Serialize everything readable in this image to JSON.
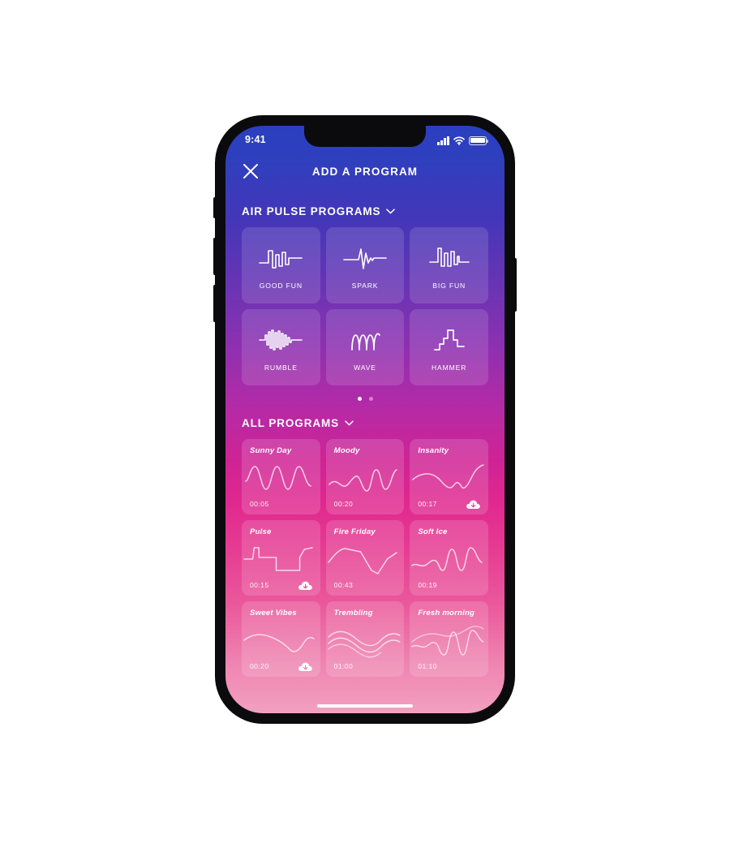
{
  "status_bar": {
    "time": "9:41",
    "signal_icon": "cellular-signal-icon",
    "wifi_icon": "wifi-icon",
    "battery_icon": "battery-icon"
  },
  "header": {
    "close_icon": "close-icon",
    "title": "ADD A PROGRAM"
  },
  "sections": {
    "air_pulse": {
      "title": "AIR PULSE PROGRAMS",
      "chevron_icon": "chevron-down-icon",
      "tiles": [
        {
          "label": "GOOD FUN",
          "icon": "waveform-good-fun-icon"
        },
        {
          "label": "SPARK",
          "icon": "waveform-spark-icon"
        },
        {
          "label": "BIG FUN",
          "icon": "waveform-big-fun-icon"
        },
        {
          "label": "RUMBLE",
          "icon": "waveform-rumble-icon"
        },
        {
          "label": "WAVE",
          "icon": "waveform-wave-icon"
        },
        {
          "label": "HAMMER",
          "icon": "waveform-hammer-icon"
        }
      ],
      "pagination": {
        "total": 2,
        "active": 1
      }
    },
    "all_programs": {
      "title": "ALL PROGRAMS",
      "chevron_icon": "chevron-down-icon",
      "programs": [
        {
          "name": "Sunny Day",
          "duration": "00:05",
          "downloadable": false
        },
        {
          "name": "Moody",
          "duration": "00:20",
          "downloadable": false
        },
        {
          "name": "Insanity",
          "duration": "00:17",
          "downloadable": true
        },
        {
          "name": "Pulse",
          "duration": "00:15",
          "downloadable": true
        },
        {
          "name": "Fire Friday",
          "duration": "00:43",
          "downloadable": false
        },
        {
          "name": "Soft Ice",
          "duration": "00:19",
          "downloadable": false
        },
        {
          "name": "Sweet Vibes",
          "duration": "00:20",
          "downloadable": true
        },
        {
          "name": "Trembling",
          "duration": "01:00",
          "downloadable": false
        },
        {
          "name": "Fresh  morning",
          "duration": "01:10",
          "downloadable": false
        }
      ]
    }
  },
  "colors": {
    "gradient_top": "#2a3fc0",
    "gradient_mid": "#b52aa6",
    "gradient_bottom": "#f2a0c0",
    "tile_surface": "rgba(255,255,255,0.13)",
    "text": "#ffffff"
  },
  "home_indicator": "home-indicator"
}
